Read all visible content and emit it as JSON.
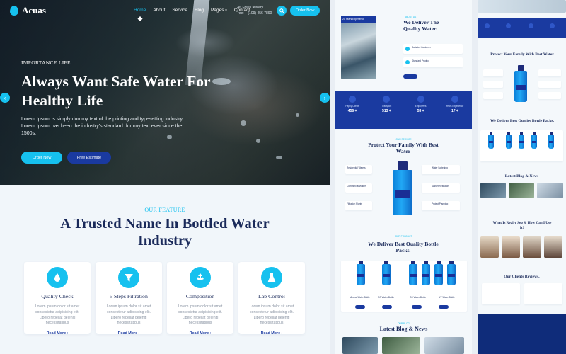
{
  "brand": {
    "name": "Acuas"
  },
  "nav": {
    "items": [
      "Home",
      "About",
      "Service",
      "Blog",
      "Pages",
      "Contact"
    ],
    "active": "Home",
    "delivery_label": "Get Free Delivery",
    "delivery_phone": "Free: + (109) 456 7890",
    "order_button": "Order Now"
  },
  "hero": {
    "eyebrow": "IMPORTANCE LIFE",
    "title": "Always Want Safe Water For Healthy Life",
    "text": "Lorem Ipsum is simply dummy text of the printing and typesetting industry. Lorem Ipsum has been the industry's standard dummy text ever since the 1500s,",
    "primary_button": "Order Now",
    "secondary_button": "Free Estimate",
    "prev_label": "‹",
    "next_label": "›"
  },
  "features": {
    "eyebrow": "OUR FEATURE",
    "title": "A Trusted Name In Bottled Water Industry",
    "cards": [
      {
        "title": "Quality Check",
        "text": "Lorem ipsum dolor sit amet consectetur adipisicing elit. Libero repellat deleniti necessitatibus",
        "link": "Read More ›",
        "icon": "water-tap-icon"
      },
      {
        "title": "5 Steps Filtration",
        "text": "Lorem ipsum dolor sit amet consectetur adipisicing elit. Libero repellat deleniti necessitatibus",
        "link": "Read More ›",
        "icon": "filter-funnel-icon"
      },
      {
        "title": "Composition",
        "text": "Lorem ipsum dolor sit amet consectetur adipisicing elit. Libero repellat deleniti necessitatibus",
        "link": "Read More ›",
        "icon": "recycle-icon"
      },
      {
        "title": "Lab Control",
        "text": "Lorem ipsum dolor sit amet consectetur adipisicing elit. Libero repellat deleniti necessitatibus",
        "link": "Read More ›",
        "icon": "lab-flask-icon"
      }
    ]
  },
  "preview_desktop": {
    "about_eyebrow": "ABOUT US",
    "experience_badge": "20 Years Experience",
    "about_title": "We Deliver The Quality Water.",
    "about_items": [
      "Satisfied Customer",
      "Standard Product"
    ],
    "stats": [
      {
        "label": "Happy Clients",
        "value": "456 +"
      },
      {
        "label": "Transport",
        "value": "513 +"
      },
      {
        "label": "Employees",
        "value": "53 +"
      },
      {
        "label": "Years Experience",
        "value": "17 +"
      }
    ],
    "protect_eyebrow": "OUR SERVICE",
    "protect_title": "Protect Your Family With Best Water",
    "protect_left": [
      "Residential Waters",
      "Commercial Waters",
      "Filtration Plants"
    ],
    "protect_right": [
      "Water Softening",
      "Market Research",
      "Project Planning"
    ],
    "packs_eyebrow": "OUR PRODUCT",
    "packs_title": "We Deliver Best Quality Bottle Packs.",
    "packs": [
      "Mineral Water Bottle",
      "RO Water Bottle",
      "RO Water Bottle",
      "UV Water Bottle"
    ],
    "blog_eyebrow": "OUR BLOG",
    "blog_title": "Latest Blog & News"
  },
  "preview_mobile": {
    "protect_title": "Protect Your Family With Best Water",
    "packs_title": "We Deliver Best Quality Bottle Packs.",
    "blog_title": "Latest Blog & News",
    "team_title": "What Is Really Seo & How Can I Use It?",
    "reviews_title": "Our Clients Reviews."
  },
  "colors": {
    "accent": "#16c1ef",
    "navy": "#1a3aa0",
    "heading": "#1a2a5a"
  }
}
